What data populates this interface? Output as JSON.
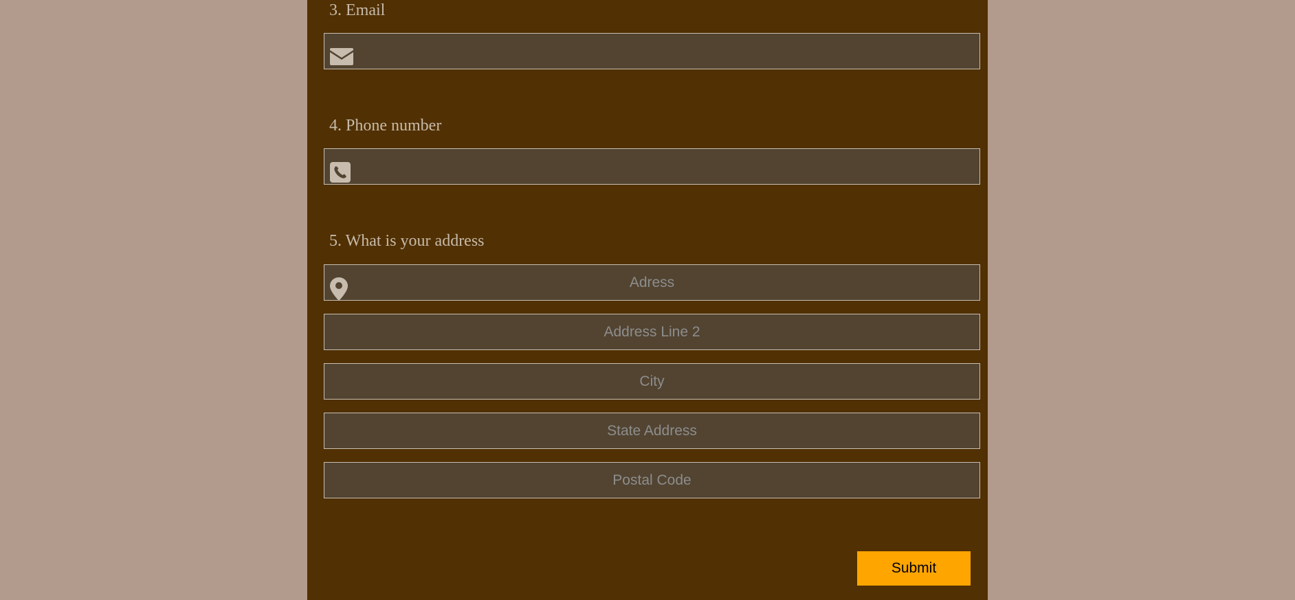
{
  "form": {
    "questions": {
      "email": {
        "label": "3. Email",
        "placeholder": ""
      },
      "phone": {
        "label": "4. Phone number",
        "placeholder": ""
      },
      "address": {
        "label": "5. What is your address",
        "line1_placeholder": "Adress",
        "line2_placeholder": "Address Line 2",
        "city_placeholder": "City",
        "state_placeholder": "State Address",
        "postal_placeholder": "Postal Code"
      }
    },
    "submit_label": "Submit"
  },
  "icons": {
    "email": "envelope-icon",
    "phone": "phone-icon",
    "address": "map-pin-icon"
  },
  "colors": {
    "page_background": "#b29a8c",
    "panel_background": "#513003",
    "field_background": "#524431",
    "field_border": "#c8c0b2",
    "label_text": "#c7bbaa",
    "placeholder_text": "#8d8d8d",
    "icon": "#c8bcae",
    "submit_background": "#ffa500",
    "submit_text": "#000000"
  }
}
